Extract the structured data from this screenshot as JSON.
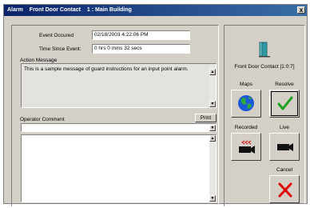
{
  "window": {
    "title_parts": [
      "Alarm",
      "Front Door Contact",
      "1 : Main Building"
    ],
    "close_glyph": "x"
  },
  "event": {
    "occurred_label": "Event Occured",
    "occurred_value": "02/18/2003 4:22:06 PM",
    "since_label": "Time Since Event:",
    "since_value": "0 hrs  0 mins  32 secs"
  },
  "action": {
    "label": "Action Message",
    "text": "This is a sample message of guard instructions for an input point alarm."
  },
  "operator": {
    "label": "Operator Comment",
    "print_label": "Print",
    "comment_value": "",
    "text": ""
  },
  "point": {
    "name": "Front Door Contact  [1:0:7]",
    "icon": "door-icon"
  },
  "buttons": {
    "maps_label": "Maps",
    "resolve_label": "Resolve",
    "recorded_label": "Recorded",
    "live_label": "Live",
    "cancel_label": "Cancel"
  },
  "icons": {
    "maps": "globe-icon",
    "resolve": "checkmark-icon",
    "recorded": "rewind-camera-icon",
    "live": "camera-icon",
    "cancel": "x-icon"
  },
  "colors": {
    "titlebar": "#0a246a",
    "check": "#1fa01f",
    "cancel_x": "#e00000",
    "globe": "#1a5ad8",
    "door": "#2f9aa0"
  }
}
